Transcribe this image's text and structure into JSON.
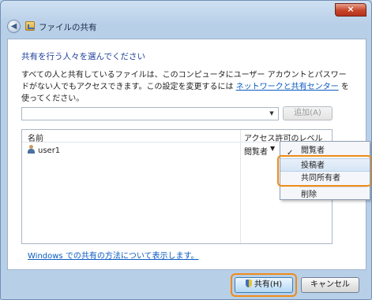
{
  "window": {
    "title": "ファイルの共有",
    "close_label": "×",
    "back_label": "◀"
  },
  "main": {
    "heading": "共有を行う人々を選んでください",
    "desc_part1": "すべての人と共有しているファイルは、このコンピュータにユーザー アカウントとパスワードがない人でもアクセスできます。この設定を変更するには ",
    "desc_link": "ネットワークと共有センター",
    "desc_part2": " を使ってください。",
    "combo_value": "",
    "add_button": "追加(A)"
  },
  "list": {
    "columns": [
      "名前",
      "アクセス許可のレベル"
    ],
    "rows": [
      {
        "name": "user1",
        "level": "閲覧者"
      }
    ]
  },
  "menu": {
    "items": [
      "閲覧者",
      "投稿者",
      "共同所有者",
      "削除"
    ],
    "checked": "閲覧者",
    "highlighted": "投稿者",
    "check_mark": "✓",
    "dropdown_arrow": "▼"
  },
  "footer": {
    "help_link": "Windows での共有の方法について表示します。",
    "share_button": "共有(H)",
    "cancel_button": "キャンセル"
  },
  "colors": {
    "highlight_box": "#ef8b19",
    "link": "#0b5bc1",
    "heading": "#1e3f99"
  }
}
